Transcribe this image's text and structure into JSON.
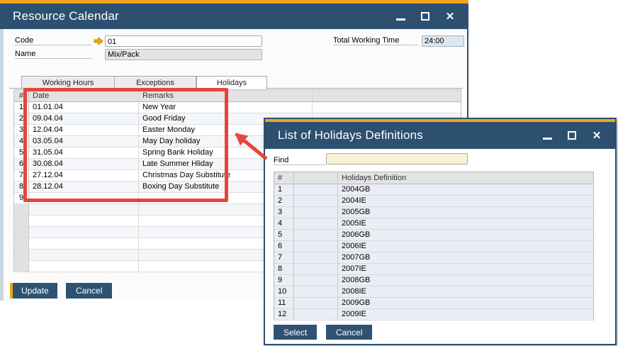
{
  "colors": {
    "titlebar_blue": "#2d5070",
    "accent_gold": "#efa31f",
    "highlight_red": "#e7453c",
    "button_blue": "#2e5272",
    "find_input_bg": "#f8f1d8"
  },
  "resource_calendar": {
    "title": "Resource Calendar",
    "code_label": "Code",
    "code_value": "01",
    "name_label": "Name",
    "name_value": "Mix/Pack",
    "total_working_time_label": "Total Working Time",
    "total_working_time_value": "24:00",
    "tabs": [
      "Working Hours",
      "Exceptions",
      "Holidays"
    ],
    "active_tab": "Holidays",
    "table": {
      "headers": [
        "#",
        "Date",
        "Remarks"
      ],
      "rows": [
        {
          "num": "1",
          "date": "01.01.04",
          "remarks": "New Year"
        },
        {
          "num": "2",
          "date": "09.04.04",
          "remarks": "Good Friday"
        },
        {
          "num": "3",
          "date": "12.04.04",
          "remarks": "Easter Monday"
        },
        {
          "num": "4",
          "date": "03.05.04",
          "remarks": "May Day holiday"
        },
        {
          "num": "5",
          "date": "31.05.04",
          "remarks": "Spring Bank Holiday"
        },
        {
          "num": "6",
          "date": "30.08.04",
          "remarks": "Late Summer Hliday"
        },
        {
          "num": "7",
          "date": "27.12.04",
          "remarks": "Christmas Day Substitute"
        },
        {
          "num": "8",
          "date": "28.12.04",
          "remarks": "Boxing Day Substitute"
        },
        {
          "num": "9",
          "date": "",
          "remarks": ""
        },
        {
          "num": "",
          "date": "",
          "remarks": ""
        },
        {
          "num": "",
          "date": "",
          "remarks": ""
        },
        {
          "num": "",
          "date": "",
          "remarks": ""
        },
        {
          "num": "",
          "date": "",
          "remarks": ""
        },
        {
          "num": "",
          "date": "",
          "remarks": ""
        },
        {
          "num": "",
          "date": "",
          "remarks": ""
        }
      ]
    },
    "update_button": "Update",
    "cancel_button": "Cancel"
  },
  "holidays_list": {
    "title": "List of Holidays Definitions",
    "find_label": "Find",
    "find_value": "",
    "table": {
      "headers": [
        "#",
        "",
        "Holidays Definition"
      ],
      "rows": [
        {
          "num": "1",
          "definition": "2004GB"
        },
        {
          "num": "2",
          "definition": "2004IE"
        },
        {
          "num": "3",
          "definition": "2005GB"
        },
        {
          "num": "4",
          "definition": "2005IE"
        },
        {
          "num": "5",
          "definition": "2006GB"
        },
        {
          "num": "6",
          "definition": "2006IE"
        },
        {
          "num": "7",
          "definition": "2007GB"
        },
        {
          "num": "8",
          "definition": "2007IE"
        },
        {
          "num": "9",
          "definition": "2008GB"
        },
        {
          "num": "10",
          "definition": "2008IE"
        },
        {
          "num": "11",
          "definition": "2009GB"
        },
        {
          "num": "12",
          "definition": "2009IE"
        }
      ]
    },
    "select_button": "Select",
    "cancel_button": "Cancel"
  }
}
